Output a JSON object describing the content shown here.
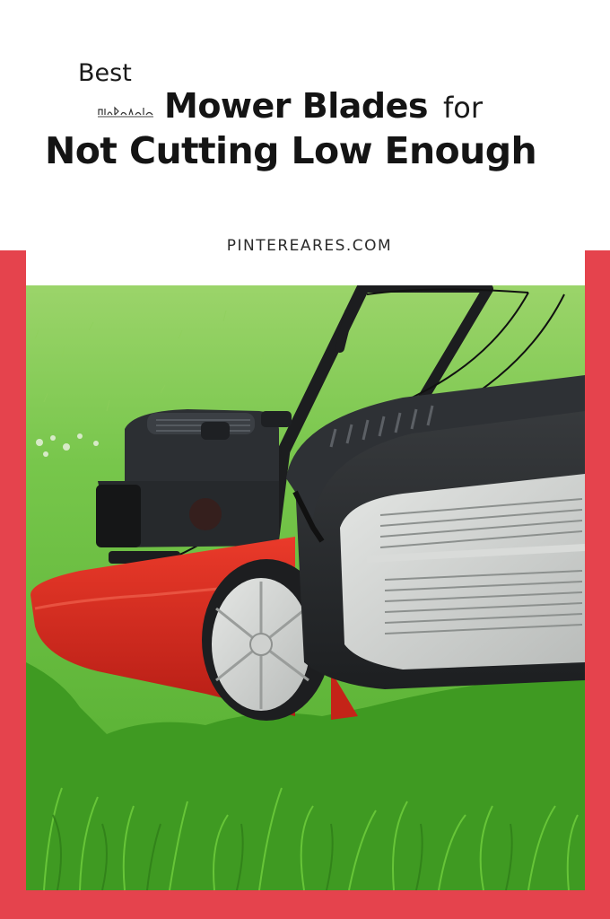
{
  "title": {
    "small": "Best",
    "main": "Mower Blades",
    "connector": "for",
    "line2": "Not Cutting Low Enough"
  },
  "site": "PINTEREARES.COM",
  "colors": {
    "frame": "#e5434d",
    "grass": "#5fbf3a",
    "mower_deck": "#d8281f",
    "mower_body": "#25282b"
  }
}
